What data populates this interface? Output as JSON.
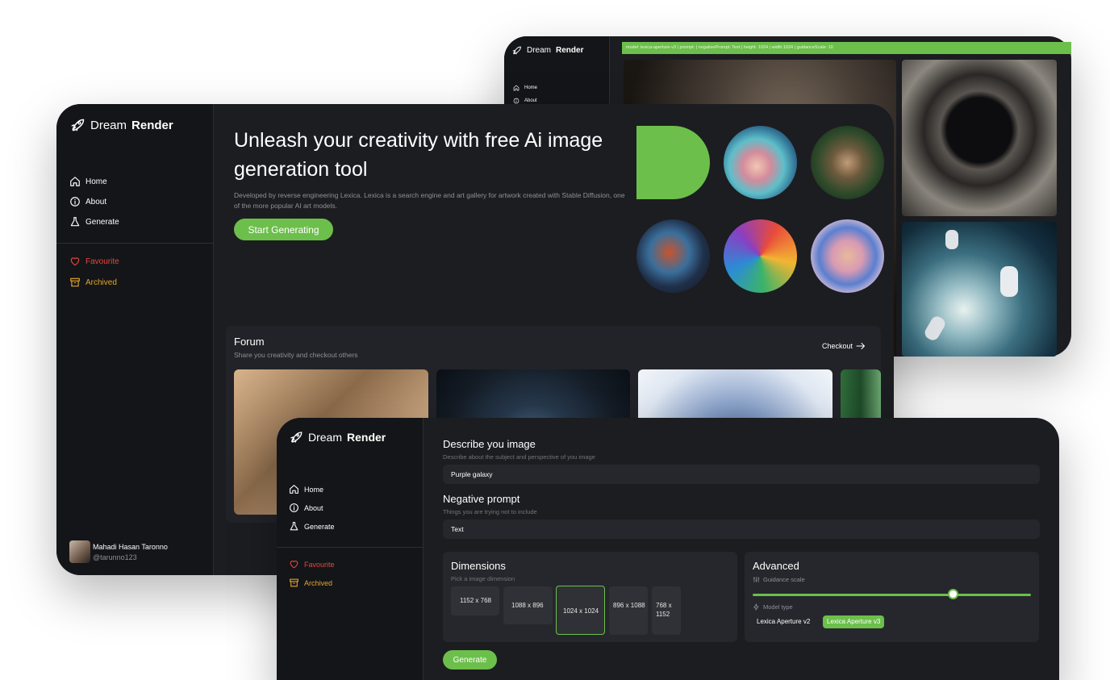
{
  "app": {
    "logo_prefix": "Dream",
    "logo_suffix": "Render"
  },
  "nav": {
    "home": "Home",
    "about": "About",
    "generate": "Generate",
    "favourite": "Favourite",
    "archived": "Archived"
  },
  "gallery_window": {
    "command_bar": "model: lexica-aperture-v3 | prompt: | negativePrompt: Text | height: 1024 | width:1024 | guidanceScale: 10"
  },
  "home_window": {
    "hero_title": "Unleash your creativity with free Ai image generation tool",
    "hero_subtitle": "Developed by reverse engineering Lexica. Lexica is a search engine and art gallery for artwork created with Stable Diffusion, one of the more popular AI art models.",
    "cta_label": "Start Generating",
    "forum_title": "Forum",
    "forum_subtitle": "Share you creativity and checkout others",
    "checkout_label": "Checkout",
    "user_name": "Mahadi Hasan Taronno",
    "user_handle": "@tarunno123"
  },
  "generate_window": {
    "describe_label": "Describe you image",
    "describe_hint": "Describe about the subject and perspective of you image",
    "describe_value": "Purple galaxy",
    "negative_label": "Negative prompt",
    "negative_hint": "Things you are trying not to include",
    "negative_value": "Text",
    "dimensions_label": "Dimensions",
    "dimensions_hint": "Pick a image dimension",
    "dimensions": [
      "1152 x 768",
      "1088 x 896",
      "1024 x 1024",
      "896 x 1088",
      "768 x 1152"
    ],
    "selected_dimension": "1024 x 1024",
    "advanced_label": "Advanced",
    "guidance_label": "Guidance scale",
    "guidance_fraction": 0.72,
    "model_type_label": "Model type",
    "models": [
      "Lexica Aperture v2",
      "Lexica Aperture v3"
    ],
    "selected_model": "Lexica Aperture v3",
    "generate_label": "Generate"
  },
  "colors": {
    "accent": "#6cbf4b",
    "background": "#1c1d21",
    "sidebar": "#141518",
    "favourite": "#e8453c",
    "archived": "#e3a52a"
  }
}
